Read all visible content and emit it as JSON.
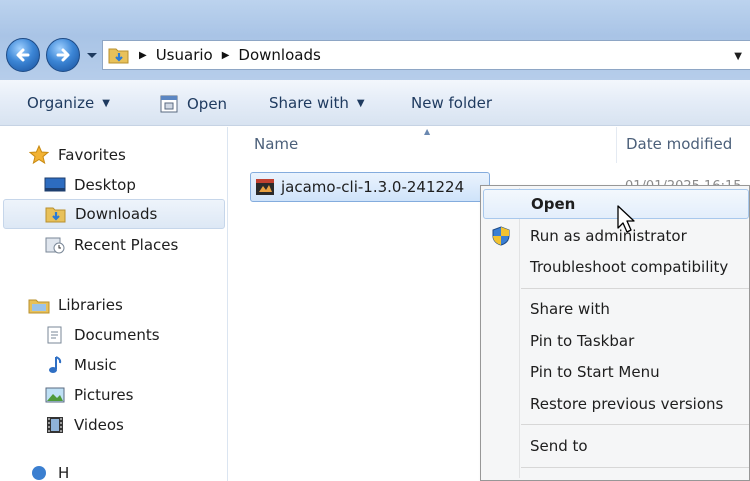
{
  "address": {
    "crumbs": [
      "Usuario",
      "Downloads"
    ]
  },
  "toolbar": {
    "organize": "Organize",
    "open": "Open",
    "share_with": "Share with",
    "new_folder": "New folder"
  },
  "navpane": {
    "favorites": "Favorites",
    "desktop": "Desktop",
    "downloads": "Downloads",
    "recent_places": "Recent Places",
    "libraries": "Libraries",
    "documents": "Documents",
    "music": "Music",
    "pictures": "Pictures",
    "videos": "Videos",
    "partial": "H"
  },
  "filelist": {
    "columns": [
      "Name",
      "Date modified"
    ],
    "file_name": "jacamo-cli-1.3.0-241224",
    "file_date": "01/01/2025 16:15"
  },
  "context_menu": {
    "items": [
      "Open",
      "Run as administrator",
      "Troubleshoot compatibility",
      "Share with",
      "Pin to Taskbar",
      "Pin to Start Menu",
      "Restore previous versions",
      "Send to"
    ]
  },
  "colors": {
    "accent": "#3c86d6",
    "selection": "#cfe3fa",
    "menu_bg": "#f5f6f7"
  }
}
